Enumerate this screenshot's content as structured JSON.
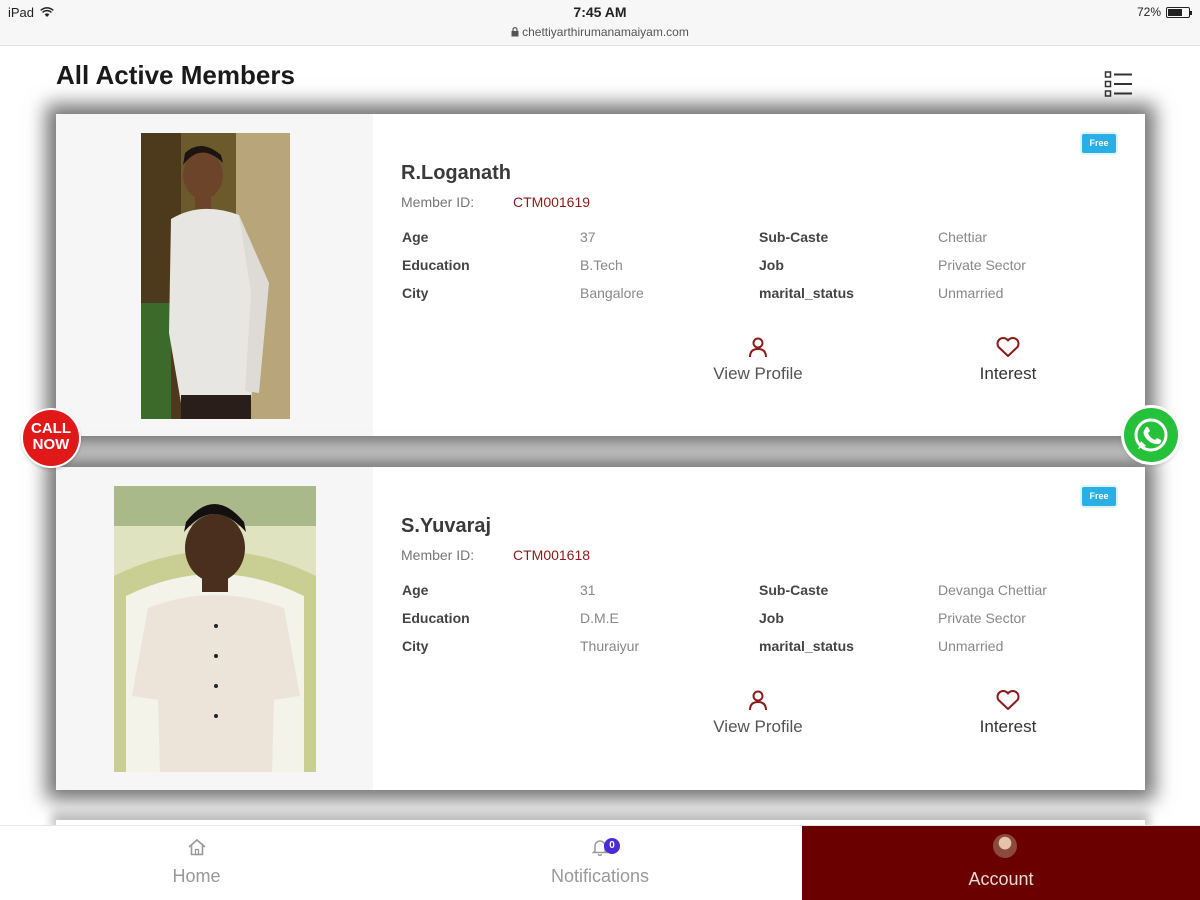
{
  "status_bar": {
    "device": "iPad",
    "time": "7:45 AM",
    "url": "chettiyarthirumanamaiyam.com",
    "battery": "72%",
    "battery_level": 0.72
  },
  "page": {
    "title": "All Active Members"
  },
  "members": [
    {
      "name": "R.Loganath",
      "member_id_label": "Member ID:",
      "member_id": "CTM001619",
      "badge": "Free",
      "fields": {
        "age_label": "Age",
        "age": "37",
        "education_label": "Education",
        "education": "B.Tech",
        "city_label": "City",
        "city": "Bangalore",
        "subcaste_label": "Sub-Caste",
        "subcaste": "Chettiar",
        "job_label": "Job",
        "job": "Private Sector",
        "marital_label": "marital_status",
        "marital": "Unmarried"
      },
      "view_profile": "View Profile",
      "interest": "Interest"
    },
    {
      "name": "S.Yuvaraj",
      "member_id_label": "Member ID:",
      "member_id": "CTM001618",
      "badge": "Free",
      "fields": {
        "age_label": "Age",
        "age": "31",
        "education_label": "Education",
        "education": "D.M.E",
        "city_label": "City",
        "city": "Thuraiyur",
        "subcaste_label": "Sub-Caste",
        "subcaste": "Devanga Chettiar",
        "job_label": "Job",
        "job": "Private Sector",
        "marital_label": "marital_status",
        "marital": "Unmarried"
      },
      "view_profile": "View Profile",
      "interest": "Interest"
    }
  ],
  "floating": {
    "call_now": "CALL NOW"
  },
  "bottom_nav": {
    "home": "Home",
    "notifications": "Notifications",
    "notifications_count": "0",
    "account": "Account"
  },
  "colors": {
    "accent_maroon": "#6b0000",
    "member_id": "#8b1a1a",
    "free_badge": "#29aee6",
    "call_now": "#e01818",
    "whatsapp": "#25c13b",
    "notif_badge": "#4a2bd6"
  },
  "icons": [
    "wifi-icon",
    "lock-icon",
    "battery-icon",
    "list-view-icon",
    "user-icon",
    "heart-icon",
    "whatsapp-icon",
    "home-icon",
    "bell-icon"
  ]
}
